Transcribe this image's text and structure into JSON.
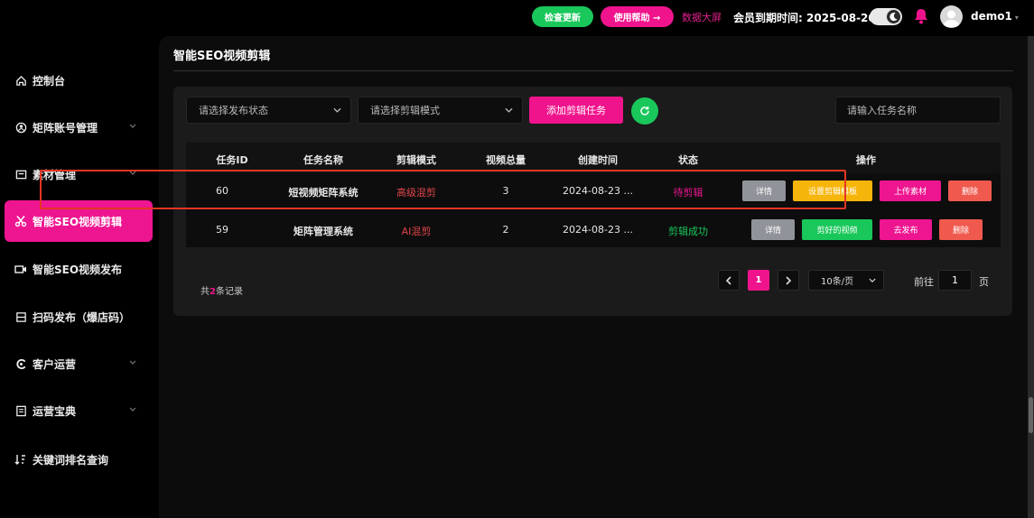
{
  "header": {
    "check_update": "检查更新",
    "help": "使用帮助 →",
    "data_screen": "数据大屏",
    "member_label": "会员到期时间:",
    "member_date": "2025-08-20",
    "username": "demo1"
  },
  "sidebar": {
    "items": [
      {
        "label": "控制台",
        "icon": "home-icon",
        "chevron": false,
        "active": false
      },
      {
        "label": "矩阵账号管理",
        "icon": "account-icon",
        "chevron": true,
        "active": false
      },
      {
        "label": "素材管理",
        "icon": "folder-icon",
        "chevron": true,
        "active": false
      },
      {
        "label": "智能SEO视频剪辑",
        "icon": "scissors-icon",
        "chevron": false,
        "active": true
      },
      {
        "label": "智能SEO视频发布",
        "icon": "video-icon",
        "chevron": false,
        "active": false
      },
      {
        "label": "扫码发布（爆店码）",
        "icon": "qr-icon",
        "chevron": false,
        "active": false
      },
      {
        "label": "客户运营",
        "icon": "customer-icon",
        "chevron": true,
        "active": false
      },
      {
        "label": "运营宝典",
        "icon": "book-icon",
        "chevron": true,
        "active": false
      },
      {
        "label": "关键词排名查询",
        "icon": "sort-icon",
        "chevron": false,
        "active": false
      }
    ]
  },
  "main": {
    "title": "智能SEO视频剪辑",
    "filters": {
      "status_placeholder": "请选择发布状态",
      "mode_placeholder": "请选择剪辑模式",
      "add_button": "添加剪辑任务",
      "search_placeholder": "请输入任务名称"
    },
    "table": {
      "columns": [
        "任务ID",
        "任务名称",
        "剪辑模式",
        "视频总量",
        "创建时间",
        "状态",
        "操作"
      ],
      "rows": [
        {
          "id": "60",
          "name": "短视频矩阵系统",
          "mode": "高级混剪",
          "total": "3",
          "created": "2024-08-23 ...",
          "status": "待剪辑",
          "actions": [
            {
              "label": "详情",
              "color": "#909399"
            },
            {
              "label": "设置剪辑模板",
              "color": "#f6b50b"
            },
            {
              "label": "上传素材",
              "color": "#ee1590"
            },
            {
              "label": "删除",
              "color": "#f05a4e"
            }
          ]
        },
        {
          "id": "59",
          "name": "矩阵管理系统",
          "mode": "AI混剪",
          "total": "2",
          "created": "2024-08-23 ...",
          "status": "剪辑成功",
          "actions": [
            {
              "label": "详情",
              "color": "#909399"
            },
            {
              "label": "剪好的视频",
              "color": "#19c75a"
            },
            {
              "label": "去发布",
              "color": "#ee1590"
            },
            {
              "label": "删除",
              "color": "#f05a4e"
            }
          ]
        }
      ]
    },
    "pagination": {
      "total_prefix": "共",
      "total_count": "2",
      "total_suffix": "条记录",
      "current_page": "1",
      "page_size": "10条/页",
      "goto_label": "前往",
      "goto_value": "1",
      "page_unit": "页"
    }
  },
  "colors": {
    "accent": "#ee1590",
    "success": "#19c75a",
    "mode_red": "#e0454a",
    "status_pending": "#ee1590",
    "status_success": "#19c75a"
  }
}
